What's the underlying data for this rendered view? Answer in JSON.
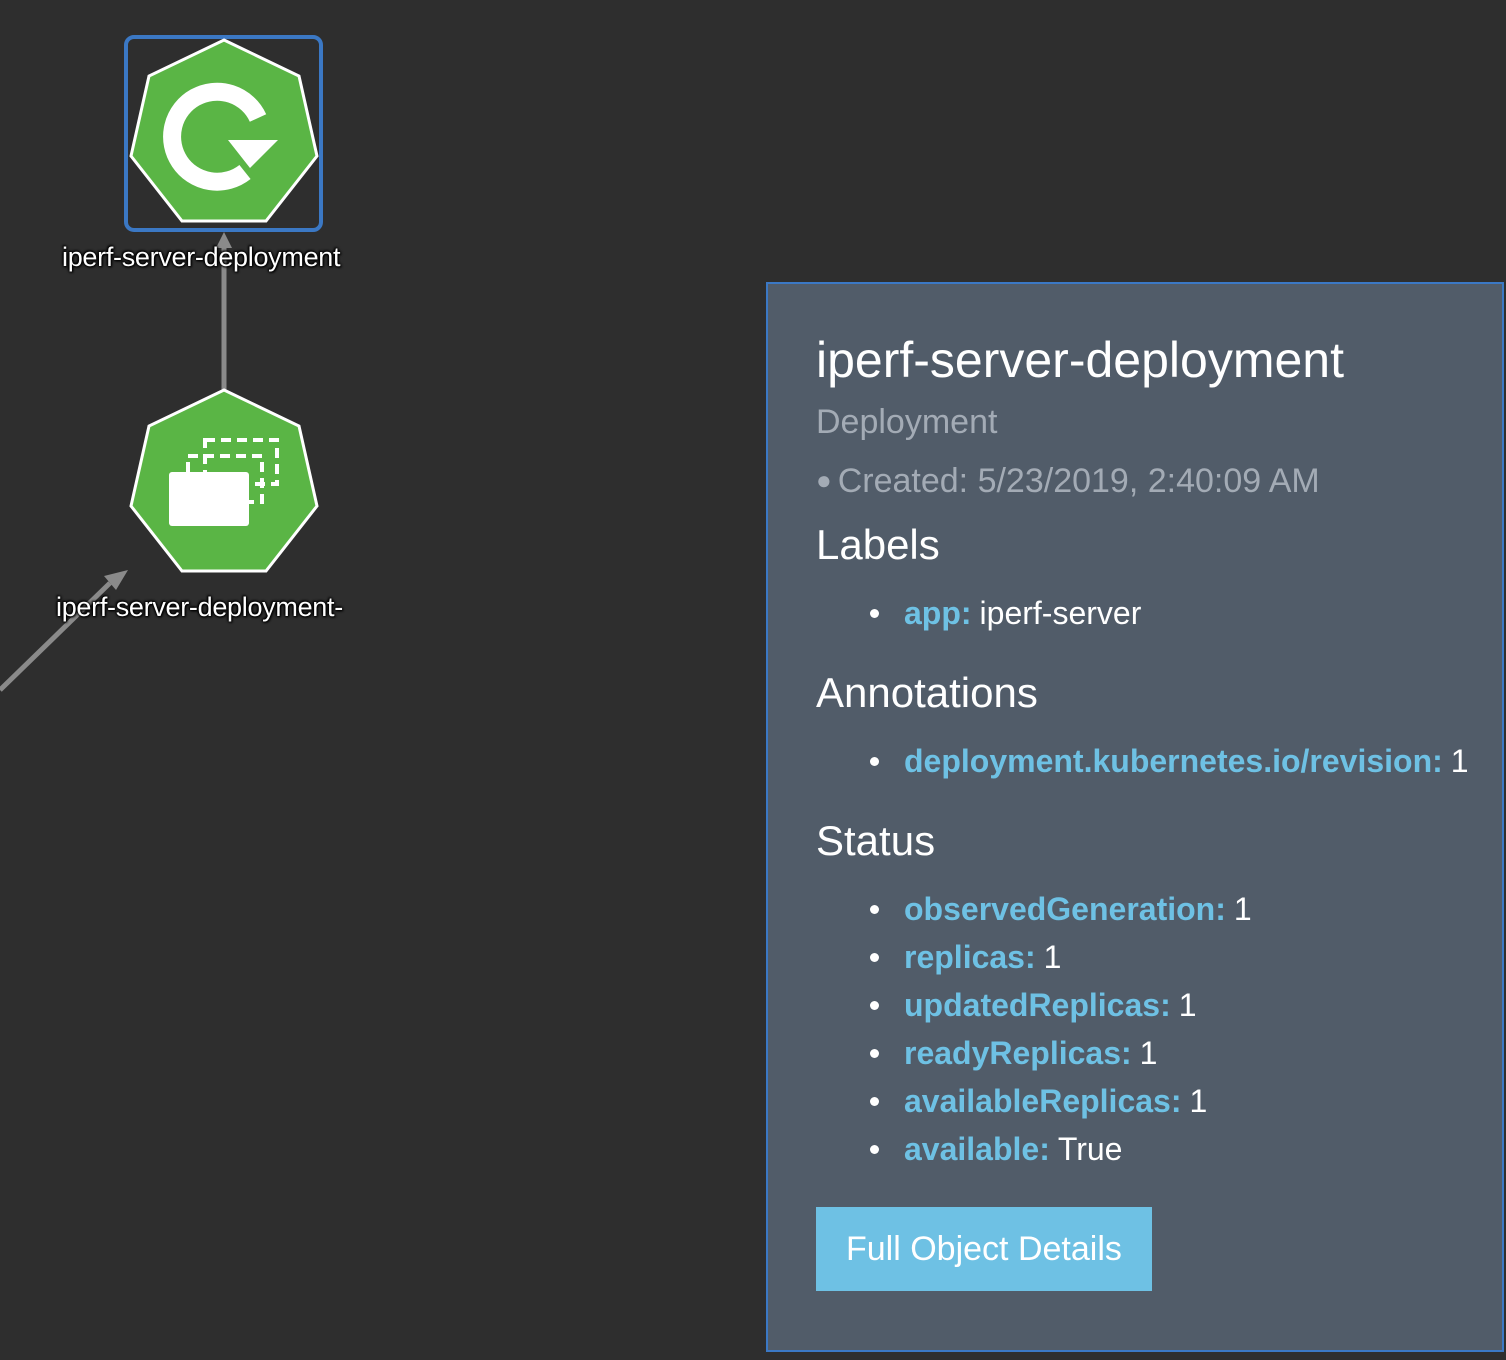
{
  "graph": {
    "nodes": [
      {
        "id": "deployment",
        "label": "iperf-server-deployment",
        "icon": "deployment-icon",
        "selected": true
      },
      {
        "id": "replicaset",
        "label": "iperf-server-deployment-",
        "icon": "replicaset-icon",
        "selected": false
      }
    ]
  },
  "colors": {
    "background": "#2e2e2e",
    "node_green": "#5ab545",
    "selection_border": "#3b78c4",
    "panel_bg": "#515c69",
    "key_blue": "#6ec1e4",
    "edge_gray": "#8a8a8a"
  },
  "panel": {
    "title": "iperf-server-deployment",
    "kind": "Deployment",
    "created": "Created: 5/23/2019, 2:40:09 AM",
    "sections": {
      "labels": {
        "heading": "Labels",
        "items": [
          {
            "key": "app:",
            "value": "iperf-server"
          }
        ]
      },
      "annotations": {
        "heading": "Annotations",
        "items": [
          {
            "key": "deployment.kubernetes.io/revision:",
            "value": "1"
          }
        ]
      },
      "status": {
        "heading": "Status",
        "items": [
          {
            "key": "observedGeneration:",
            "value": "1"
          },
          {
            "key": "replicas:",
            "value": "1"
          },
          {
            "key": "updatedReplicas:",
            "value": "1"
          },
          {
            "key": "readyReplicas:",
            "value": "1"
          },
          {
            "key": "availableReplicas:",
            "value": "1"
          },
          {
            "key": "available:",
            "value": "True"
          }
        ]
      }
    },
    "button_label": "Full Object Details"
  }
}
